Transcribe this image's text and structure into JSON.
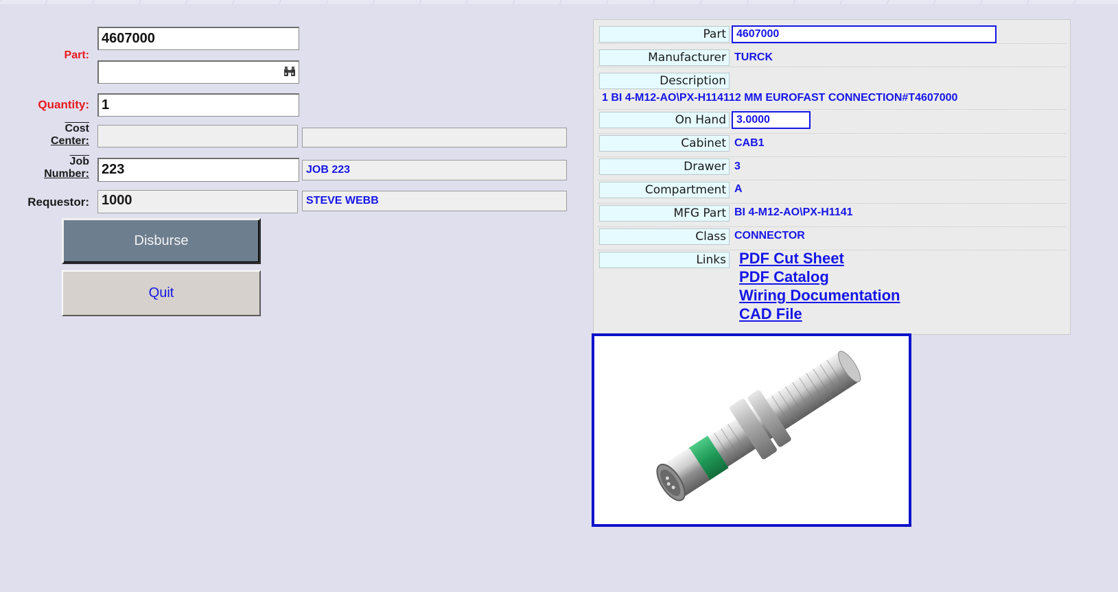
{
  "form": {
    "part_label": "Part:",
    "part_value": "4607000",
    "part_search_value": "",
    "quantity_label": "Quantity:",
    "quantity_value": "1",
    "cost_center_label_1": "Cost",
    "cost_center_label_2": "Center:",
    "cost_center_value": "",
    "cost_center_desc": "",
    "job_label_1": "Job",
    "job_label_2": "Number:",
    "job_value": "223",
    "job_desc": "JOB 223",
    "requestor_label": "Requestor:",
    "requestor_value": "1000",
    "requestor_desc": "STEVE WEBB",
    "disburse_label": "Disburse",
    "quit_label": "Quit"
  },
  "details": {
    "part_label": "Part",
    "part_value": "4607000",
    "manufacturer_label": "Manufacturer",
    "manufacturer_value": "TURCK",
    "description_label": "Description",
    "description_value": "1 BI 4-M12-AO\\PX-H114112 MM EUROFAST CONNECTION#T4607000",
    "on_hand_label": "On Hand",
    "on_hand_value": "3.0000",
    "cabinet_label": "Cabinet",
    "cabinet_value": "CAB1",
    "drawer_label": "Drawer",
    "drawer_value": "3",
    "compartment_label": "Compartment",
    "compartment_value": "A",
    "mfg_part_label": "MFG Part",
    "mfg_part_value": "BI 4-M12-AO\\PX-H1141",
    "class_label": "Class",
    "class_value": "CONNECTOR",
    "links_label": "Links",
    "links": [
      "PDF Cut Sheet",
      "PDF Catalog",
      "Wiring Documentation",
      "CAD File"
    ]
  },
  "icons": {
    "search": "binoculars-icon"
  },
  "colors": {
    "background": "#e0dfee",
    "label_red": "#e8191e",
    "value_blue": "#1515e8",
    "disburse_button": "#6d7e8f",
    "quit_button": "#d6d1cc",
    "image_border": "#0b13c9"
  }
}
